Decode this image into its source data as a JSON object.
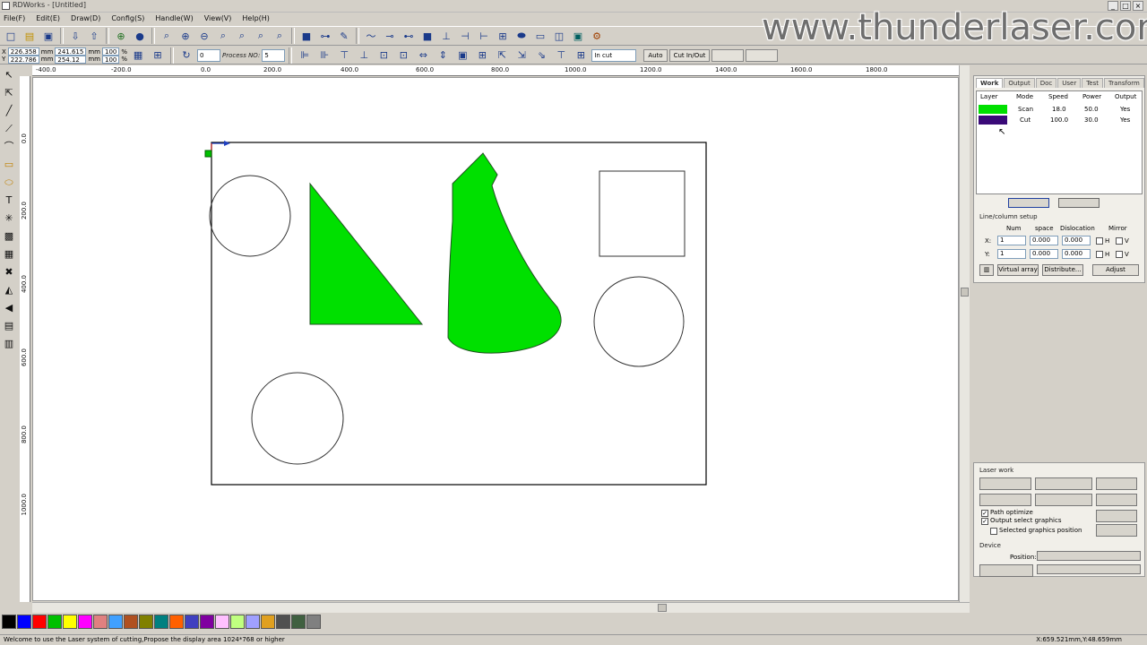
{
  "window": {
    "title": "RDWorks - [Untitled]",
    "controls": [
      "_",
      "□",
      "×"
    ]
  },
  "watermark": "www.thunderlaser.com",
  "menu": [
    "File(F)",
    "Edit(E)",
    "Draw(D)",
    "Config(S)",
    "Handle(W)",
    "View(V)",
    "Help(H)"
  ],
  "toolbar2": {
    "x_label": "X",
    "y_label": "Y",
    "x_pos": "226.358",
    "y_pos": "222.786",
    "x_size": "241.615",
    "y_size": "254.12",
    "x_scale": "100",
    "y_scale": "100",
    "pct": "%",
    "mm": "mm",
    "rotate_value": "0",
    "process_no_label": "Process NO:",
    "process_no_value": "5",
    "cut_mode": "In cut",
    "auto_label": "Auto",
    "cut_in_out_label": "Cut In/Out"
  },
  "rulers": {
    "h_labels": [
      "-400.0",
      "-200.0",
      "0.0",
      "200.0",
      "400.0",
      "600.0",
      "800.0",
      "1000.0",
      "1200.0",
      "1400.0",
      "1600.0",
      "1800.0"
    ],
    "v_labels": [
      "0.0",
      "200.0",
      "400.0",
      "600.0",
      "800.0",
      "1000.0"
    ]
  },
  "layers_panel": {
    "tabs": [
      "Work",
      "Output",
      "Doc",
      "User",
      "Test",
      "Transform"
    ],
    "headers": [
      "Layer",
      "Mode",
      "Speed",
      "Power",
      "Output"
    ],
    "rows": [
      {
        "color": "#00e000",
        "mode": "Scan",
        "speed": "18.0",
        "power": "50.0",
        "output": "Yes"
      },
      {
        "color": "#3a0a78",
        "mode": "Cut",
        "speed": "100.0",
        "power": "30.0",
        "output": "Yes"
      }
    ]
  },
  "array_setup": {
    "title": "Line/column setup",
    "headers": [
      "Num",
      "space",
      "Dislocation",
      "Mirror"
    ],
    "x_label": "X:",
    "y_label": "Y:",
    "x_num": "1",
    "y_num": "1",
    "x_space": "0.000",
    "y_space": "0.000",
    "x_disloc": "0.000",
    "y_disloc": "0.000",
    "mirror_h": "H",
    "mirror_v": "V",
    "virtual_array": "Virtual array",
    "distribute": "Distribute...",
    "adjust": "Adjust"
  },
  "laser_work": {
    "title": "Laser work",
    "path_optimize": "Path optimize",
    "output_select": "Output select graphics",
    "selected_position": "Selected graphics position",
    "device_title": "Device",
    "position_label": "Position:"
  },
  "palette": [
    "#000000",
    "#0000ff",
    "#ff0000",
    "#00c000",
    "#ffff00",
    "#ff00ff",
    "#e08080",
    "#40a0ff",
    "#b05020",
    "#808000",
    "#008080",
    "#ff6000",
    "#4040c0",
    "#8000a0",
    "#ffc0ff",
    "#c0ff80",
    "#a0a0ff",
    "#e0a020",
    "#505050",
    "#406040",
    "#808080"
  ],
  "status": {
    "message": "Welcome to use the Laser system of cutting,Propose the display area 1024*768 or higher",
    "coords": "X:659.521mm,Y:48.659mm"
  }
}
